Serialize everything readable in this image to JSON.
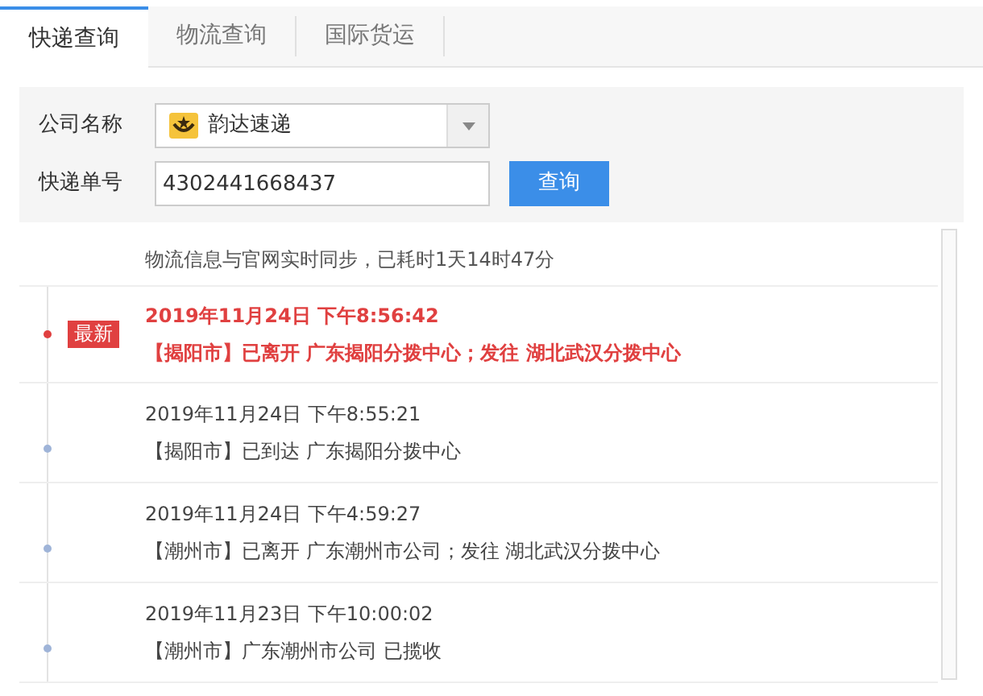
{
  "tabs": [
    {
      "label": "快递查询",
      "selected": true
    },
    {
      "label": "物流查询",
      "selected": false
    },
    {
      "label": "国际货运",
      "selected": false
    }
  ],
  "form": {
    "company_label": "公司名称",
    "company_value": "韵达速递",
    "number_label": "快递单号",
    "number_value": "4302441668437",
    "query_button": "查询"
  },
  "sync_note": "物流信息与官网实时同步，已耗时1天14时47分",
  "latest_badge": "最新",
  "events": [
    {
      "time": "2019年11月24日 下午8:56:42",
      "detail": "【揭阳市】已离开 广东揭阳分拨中心；发往 湖北武汉分拨中心",
      "latest": true
    },
    {
      "time": "2019年11月24日 下午8:55:21",
      "detail": "【揭阳市】已到达 广东揭阳分拨中心",
      "latest": false
    },
    {
      "time": "2019年11月24日 下午4:59:27",
      "detail": "【潮州市】已离开 广东潮州市公司；发往 湖北武汉分拨中心",
      "latest": false
    },
    {
      "time": "2019年11月23日 下午10:00:02",
      "detail": "【潮州市】广东潮州市公司 已揽收",
      "latest": false
    }
  ]
}
